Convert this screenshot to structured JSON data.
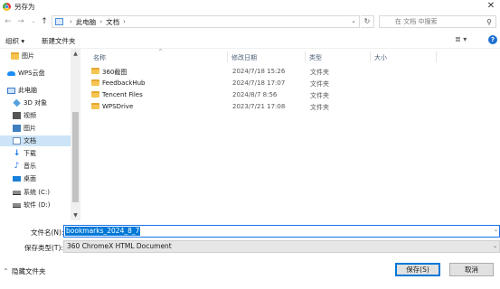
{
  "window": {
    "title": "另存为",
    "close_glyph": "✕"
  },
  "nav": {
    "back": "←",
    "forward": "→",
    "history": "⌄",
    "up": "↑"
  },
  "breadcrumb": {
    "sep": "›",
    "items": [
      "此电脑",
      "文档"
    ],
    "dropdown": "⌄",
    "refresh": "↻"
  },
  "search": {
    "placeholder": "在 文档 中搜索",
    "icon": "⚲"
  },
  "toolbar": {
    "organize": "组织 ▾",
    "new_folder": "新建文件夹",
    "view": "≣ ▾",
    "help": "?"
  },
  "sidebar": {
    "items": [
      {
        "label": "图片",
        "icon": "folder-icon"
      },
      {
        "label": "WPS云盘",
        "icon": "cloud-icon"
      },
      {
        "label": "此电脑",
        "icon": "computer-icon"
      },
      {
        "label": "3D 对象",
        "icon": "cube-icon"
      },
      {
        "label": "视频",
        "icon": "video-icon"
      },
      {
        "label": "图片",
        "icon": "image-icon"
      },
      {
        "label": "文档",
        "icon": "document-icon",
        "selected": true
      },
      {
        "label": "下载",
        "icon": "download-icon"
      },
      {
        "label": "音乐",
        "icon": "music-icon"
      },
      {
        "label": "桌面",
        "icon": "desktop-icon"
      },
      {
        "label": "系统 (C:)",
        "icon": "drive-icon"
      },
      {
        "label": "软件 (D:)",
        "icon": "drive-icon"
      }
    ],
    "scroll_up": "▲",
    "scroll_down": "▼"
  },
  "filelist": {
    "columns": [
      "名称",
      "修改日期",
      "类型",
      "大小"
    ],
    "sort_arrow": "^",
    "rows": [
      {
        "name": "360截图",
        "date": "2024/7/18 15:26",
        "type": "文件夹"
      },
      {
        "name": "FeedbackHub",
        "date": "2024/7/18 17:07",
        "type": "文件夹"
      },
      {
        "name": "Tencent Files",
        "date": "2024/8/7 8:56",
        "type": "文件夹"
      },
      {
        "name": "WPSDrive",
        "date": "2023/7/21 17:08",
        "type": "文件夹"
      }
    ]
  },
  "filename": {
    "label": "文件名(N):",
    "value": "bookmarks_2024_8_7",
    "dropdown": "⌄"
  },
  "filetype": {
    "label": "保存类型(T):",
    "value": "360 ChromeX HTML Document",
    "dropdown": "⌄"
  },
  "footer": {
    "hide_folders": "隐藏文件夹",
    "chevron": "^",
    "save": "保存(S)",
    "cancel": "取消"
  }
}
